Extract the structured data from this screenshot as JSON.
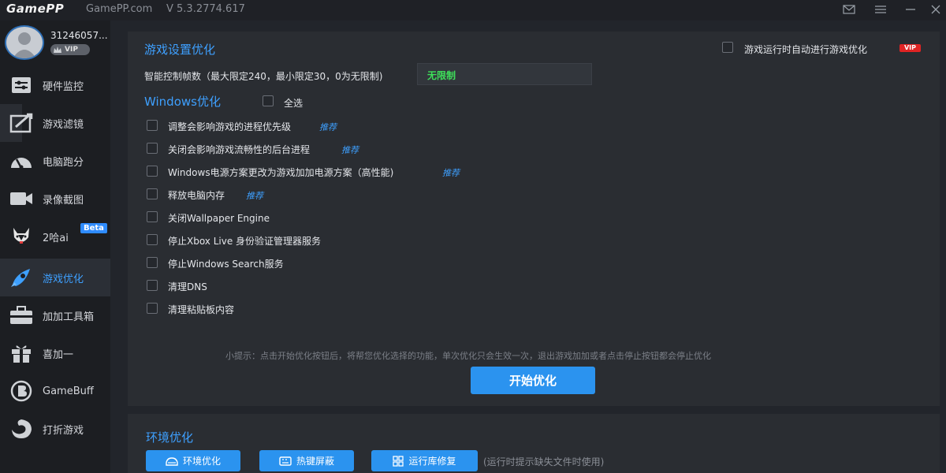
{
  "titlebar": {
    "logo": "GamePP",
    "site": "GamePP.com",
    "version": "V 5.3.2774.617",
    "icons": [
      "mail-icon",
      "menu-icon",
      "minimize-icon",
      "close-icon"
    ]
  },
  "user": {
    "name": "31246057...",
    "badge": "VIP"
  },
  "sidebar": {
    "items": [
      {
        "label": "硬件监控",
        "icon": "hardware-monitor-icon"
      },
      {
        "label": "游戏滤镜",
        "icon": "game-filter-icon"
      },
      {
        "label": "电脑跑分",
        "icon": "benchmark-gauge-icon"
      },
      {
        "label": "录像截图",
        "icon": "camera-icon"
      },
      {
        "label": "2哈ai",
        "icon": "husky-icon",
        "badge": "Beta"
      },
      {
        "label": "游戏优化",
        "icon": "rocket-icon",
        "active": true
      },
      {
        "label": "加加工具箱",
        "icon": "toolbox-icon"
      },
      {
        "label": "喜加一",
        "icon": "gift-icon"
      },
      {
        "label": "GameBuff",
        "icon": "gamebuff-icon"
      },
      {
        "label": "打折游戏",
        "icon": "discount-icon"
      }
    ]
  },
  "game_settings": {
    "title": "游戏设置优化",
    "auto_label": "游戏运行时自动进行游戏优化",
    "vip_tag": "VIP",
    "fps_label": "智能控制帧数（最大限定240，最小限定30，0为无限制)",
    "fps_value": "无限制"
  },
  "windows_opt": {
    "title": "Windows优化",
    "select_all": "全选",
    "recommend": "推荐",
    "options": [
      {
        "label": "调整会影响游戏的进程优先级",
        "recommended": true
      },
      {
        "label": "关闭会影响游戏流畅性的后台进程",
        "recommended": true
      },
      {
        "label": "Windows电源方案更改为游戏加加电源方案（高性能)",
        "recommended": true
      },
      {
        "label": "释放电脑内存",
        "recommended": true
      },
      {
        "label": "关闭Wallpaper Engine",
        "recommended": false
      },
      {
        "label": "停止Xbox Live 身份验证管理器服务",
        "recommended": false
      },
      {
        "label": "停止Windows Search服务",
        "recommended": false
      },
      {
        "label": "清理DNS",
        "recommended": false
      },
      {
        "label": "清理粘贴板内容",
        "recommended": false
      }
    ]
  },
  "tip": "小提示：点击开始优化按钮后，将帮您优化选择的功能，单次优化只会生效一次，退出游戏加加或者点击停止按钮都会停止优化",
  "start_button": "开始优化",
  "env": {
    "title": "环境优化",
    "buttons": [
      {
        "label": "环境优化",
        "icon": "env-icon"
      },
      {
        "label": "热键屏蔽",
        "icon": "keyboard-icon"
      },
      {
        "label": "运行库修复",
        "icon": "grid-icon"
      }
    ],
    "note": "(运行时提示缺失文件时使用)"
  },
  "colors": {
    "accent": "#3ea0ff",
    "button": "#2b93ef",
    "fps_green": "#3ee05a",
    "vip_red": "#e02424"
  }
}
